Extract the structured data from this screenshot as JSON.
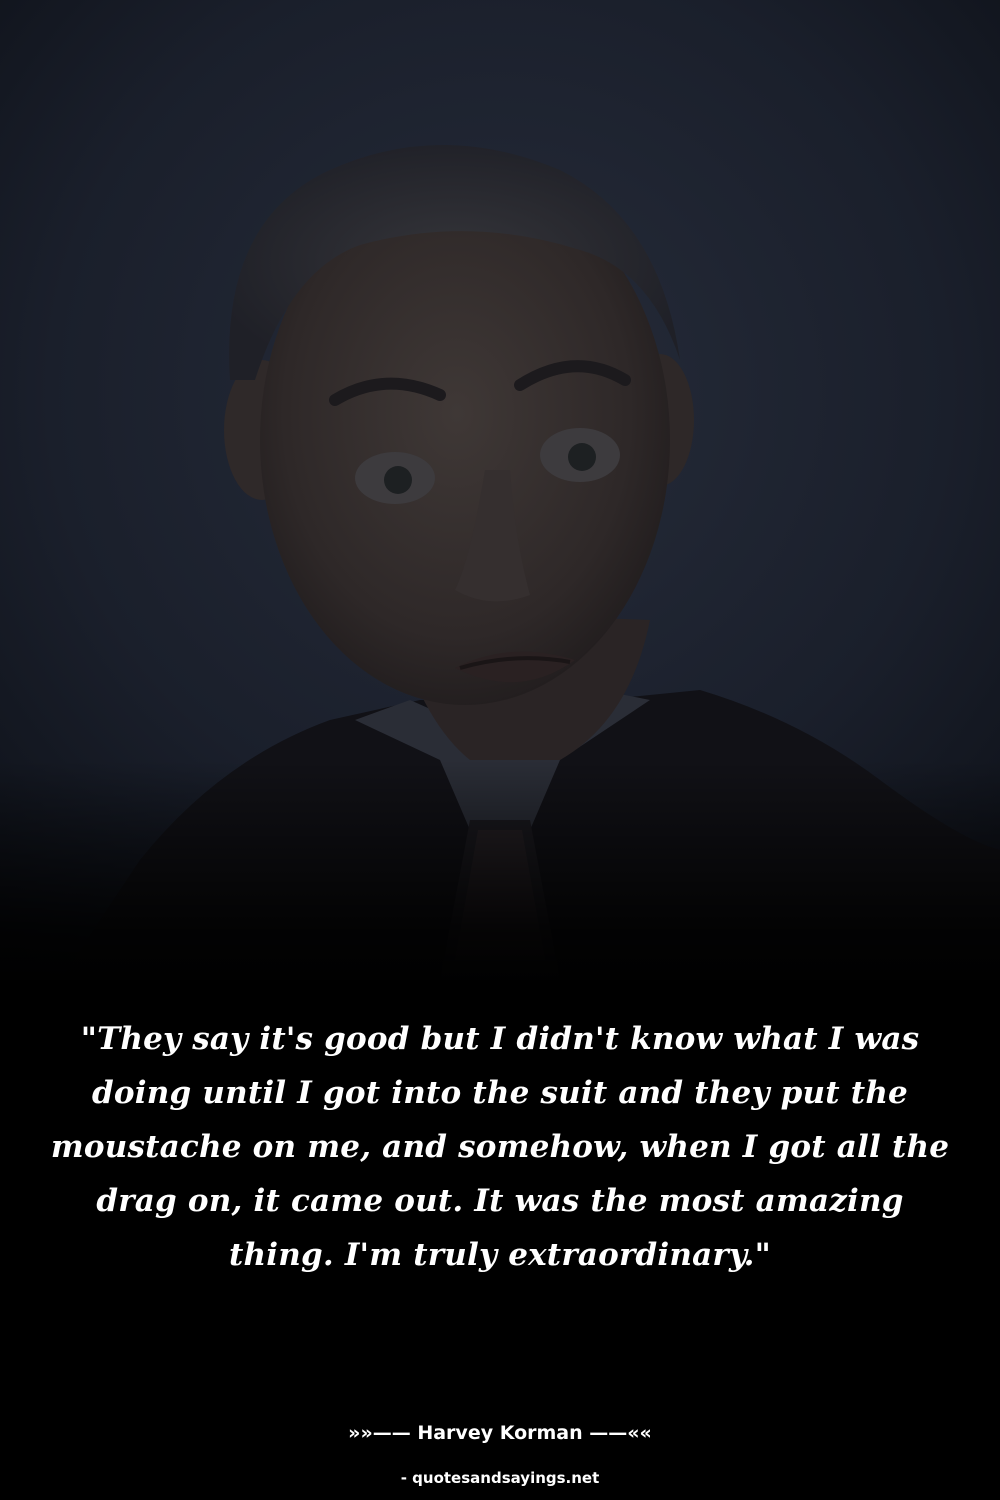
{
  "quote": {
    "text": "\"They say it's good but I didn't know what I was doing until I got into the suit and they put the moustache on me, and somehow, when I got all the drag on, it came out. It was the most amazing thing. I'm truly extraordinary.\""
  },
  "author": {
    "line": "»»—— Harvey Korman ——««"
  },
  "source": {
    "label": "- quotesandsayings.net"
  },
  "colors": {
    "background": "#000000",
    "text": "#ffffff",
    "backdrop": "#1f2431"
  }
}
